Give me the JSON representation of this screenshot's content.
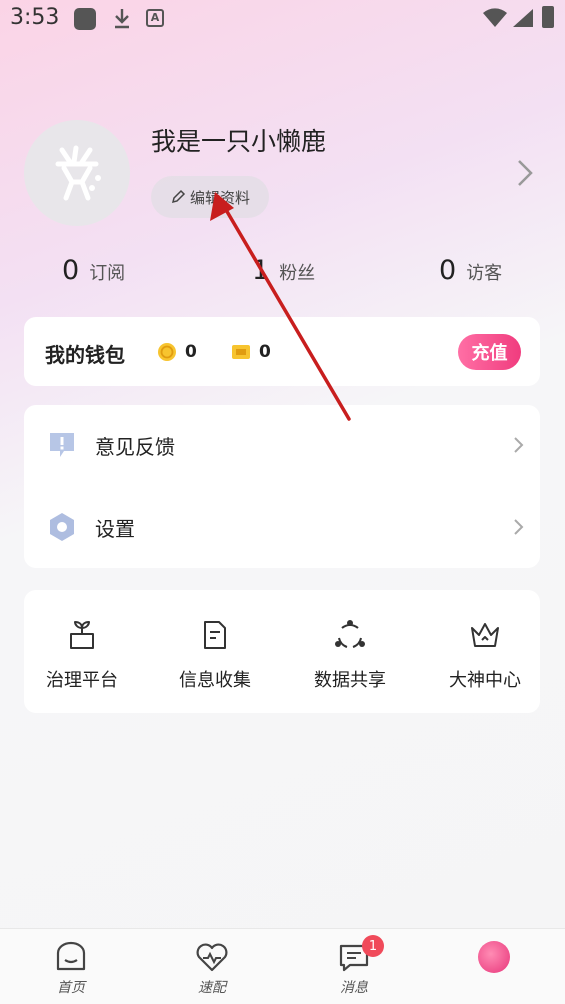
{
  "status_bar": {
    "time": "3:53",
    "a_icon_letter": "A"
  },
  "profile": {
    "username": "我是一只小懒鹿",
    "edit_label": "编辑资料"
  },
  "stats": [
    {
      "value": "0",
      "label": "订阅"
    },
    {
      "value": "1",
      "label": "粉丝"
    },
    {
      "value": "0",
      "label": "访客"
    }
  ],
  "wallet": {
    "title": "我的钱包",
    "coins": "0",
    "tickets": "0",
    "recharge_label": "充值"
  },
  "menu": [
    {
      "label": "意见反馈",
      "icon": "feedback-icon"
    },
    {
      "label": "设置",
      "icon": "settings-icon"
    }
  ],
  "grid": [
    {
      "label": "治理平台",
      "icon": "plant-icon"
    },
    {
      "label": "信息收集",
      "icon": "document-icon"
    },
    {
      "label": "数据共享",
      "icon": "share-icon"
    },
    {
      "label": "大神中心",
      "icon": "crown-icon"
    }
  ],
  "bottom_nav": [
    {
      "label": "首页",
      "icon": "home-face-icon"
    },
    {
      "label": "速配",
      "icon": "heart-pulse-icon"
    },
    {
      "label": "消息",
      "icon": "message-icon",
      "badge": "1"
    },
    {
      "label": "",
      "icon": "profile-tab-icon"
    }
  ],
  "colors": {
    "accent": "#f03c7e",
    "badge": "#f04a5a",
    "annotation": "#c81e1e"
  }
}
